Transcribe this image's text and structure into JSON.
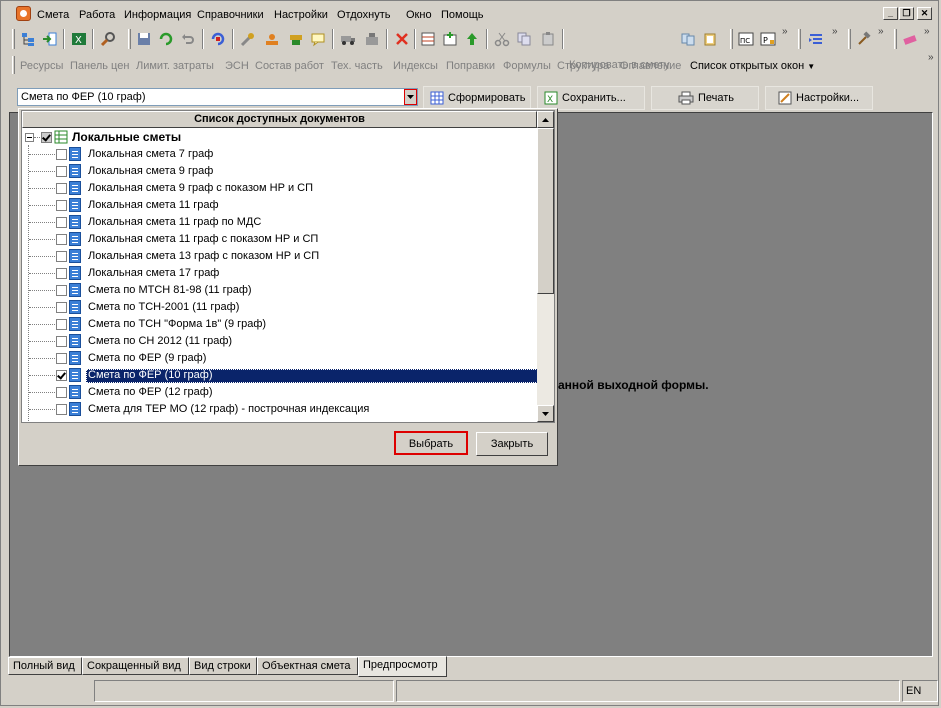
{
  "menu": {
    "items": [
      "Смета",
      "Работа",
      "Информация",
      "Справочники",
      "Настройки",
      "Отдохнуть",
      "Окно",
      "Помощь"
    ]
  },
  "toolbar": {
    "copy_to_estimate": "Копировать в смету"
  },
  "panels": {
    "items": [
      "Ресурсы",
      "Панель цен",
      "Лимит. затраты",
      "ЭСН",
      "Состав работ",
      "Тех. часть",
      "Индексы",
      "Поправки",
      "Формулы",
      "Структура",
      "Оглавление"
    ],
    "open_windows": "Список открытых окон"
  },
  "doc_toolbar": {
    "selected_form": "Смета по ФЕР (10 граф)",
    "generate": "Сформировать",
    "save": "Сохранить...",
    "print": "Печать",
    "settings": "Настройки..."
  },
  "preview_hint": "анной выходной формы.",
  "dialog": {
    "header": "Список доступных документов",
    "root_label": "Локальные сметы",
    "items": [
      {
        "label": "Локальная смета 7 граф",
        "checked": false
      },
      {
        "label": "Локальная смета 9 граф",
        "checked": false
      },
      {
        "label": "Локальная смета 9 граф с показом НР и СП",
        "checked": false
      },
      {
        "label": "Локальная смета 11 граф",
        "checked": false
      },
      {
        "label": "Локальная смета 11 граф по МДС",
        "checked": false
      },
      {
        "label": "Локальная смета 11 граф с показом НР и СП",
        "checked": false
      },
      {
        "label": "Локальная смета 13 граф с показом НР и СП",
        "checked": false
      },
      {
        "label": "Локальная смета 17 граф",
        "checked": false
      },
      {
        "label": "Смета по МТСН 81-98 (11 граф)",
        "checked": false
      },
      {
        "label": "Смета по ТСН-2001 (11 граф)",
        "checked": false
      },
      {
        "label": "Смета по ТСН \"Форма 1в\" (9 граф)",
        "checked": false
      },
      {
        "label": "Смета по СН 2012 (11 граф)",
        "checked": false
      },
      {
        "label": "Смета по ФЕР (9 граф)",
        "checked": false
      },
      {
        "label": "Смета по ФЕР (10 граф)",
        "checked": true,
        "selected": true
      },
      {
        "label": "Смета по ФЕР (12 граф)",
        "checked": false
      },
      {
        "label": "Смета для ТЕР МО (12 граф) - построчная индексация",
        "checked": false
      }
    ],
    "select_button": "Выбрать",
    "close_button": "Закрыть"
  },
  "tabs": {
    "items": [
      "Полный вид",
      "Сокращенный вид",
      "Вид строки",
      "Объектная смета",
      "Предпросмотр"
    ],
    "active": "Предпросмотр"
  },
  "status": {
    "lang": "EN"
  },
  "colors": {
    "selection": "#0a246a",
    "highlight_border": "#dd0000",
    "workspace": "#808080"
  }
}
